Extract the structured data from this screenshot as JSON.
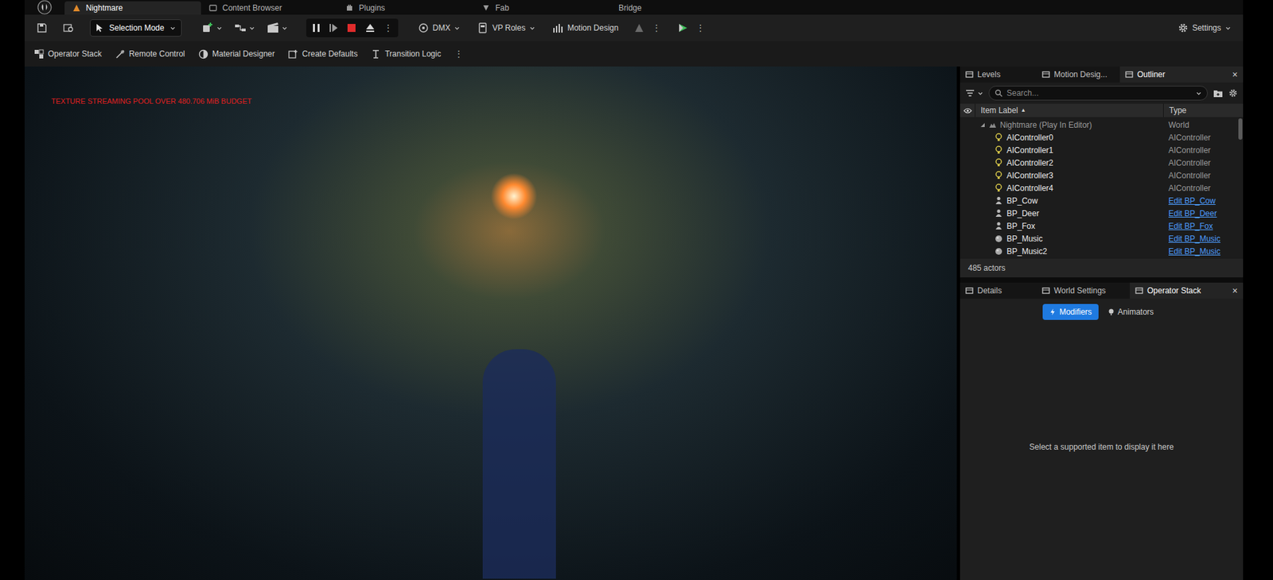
{
  "app_tabs": [
    {
      "label": "Nightmare",
      "selected": true
    },
    {
      "label": "Content Browser",
      "selected": false
    },
    {
      "label": "Plugins",
      "selected": false
    },
    {
      "label": "Fab",
      "selected": false
    },
    {
      "label": "Bridge",
      "selected": false
    }
  ],
  "toolbar": {
    "mode": "Selection Mode",
    "playing": true,
    "menus": [
      "DMX",
      "VP Roles",
      "Motion Design"
    ],
    "more": [
      "⋮",
      "⋮",
      "⋮"
    ],
    "settings": "Settings"
  },
  "secondary_toolbar": {
    "items": [
      "Operator Stack",
      "Remote Control",
      "Material Designer",
      "Create Defaults",
      "Transition Logic"
    ],
    "more": "⋮"
  },
  "viewport": {
    "warning": "TEXTURE STREAMING POOL OVER 480.706 MiB BUDGET"
  },
  "outliner": {
    "tabs": [
      {
        "label": "Levels",
        "selected": false
      },
      {
        "label": "Motion Desig...",
        "selected": false
      },
      {
        "label": "Outliner",
        "selected": true,
        "close": "×"
      }
    ],
    "search": {
      "placeholder": "Search..."
    },
    "columns": {
      "label": "Item Label",
      "sort": "▲",
      "type": "Type"
    },
    "world": {
      "label": "Nightmare (Play In Editor)",
      "type": "World",
      "expanded": true
    },
    "rows": [
      {
        "label": "AIController0",
        "type": "AIController",
        "kind": "controller"
      },
      {
        "label": "AIController1",
        "type": "AIController",
        "kind": "controller"
      },
      {
        "label": "AIController2",
        "type": "AIController",
        "kind": "controller"
      },
      {
        "label": "AIController3",
        "type": "AIController",
        "kind": "controller"
      },
      {
        "label": "AIController4",
        "type": "AIController",
        "kind": "controller"
      },
      {
        "label": "BP_Cow",
        "type": "Edit BP_Cow",
        "kind": "pawn"
      },
      {
        "label": "BP_Deer",
        "type": "Edit BP_Deer",
        "kind": "pawn"
      },
      {
        "label": "BP_Fox",
        "type": "Edit BP_Fox",
        "kind": "pawn"
      },
      {
        "label": "BP_Music",
        "type": "Edit BP_Music",
        "kind": "actor"
      },
      {
        "label": "BP_Music2",
        "type": "Edit BP_Music",
        "kind": "actor"
      }
    ],
    "count": "485 actors"
  },
  "details": {
    "tabs": [
      {
        "label": "Details",
        "selected": false
      },
      {
        "label": "World Settings",
        "selected": false
      },
      {
        "label": "Operator Stack",
        "selected": true,
        "close": "×"
      }
    ],
    "modes": [
      {
        "label": "Modifiers",
        "selected": true
      },
      {
        "label": "Animators",
        "selected": false
      }
    ],
    "empty": "Select a supported item to display it here"
  }
}
